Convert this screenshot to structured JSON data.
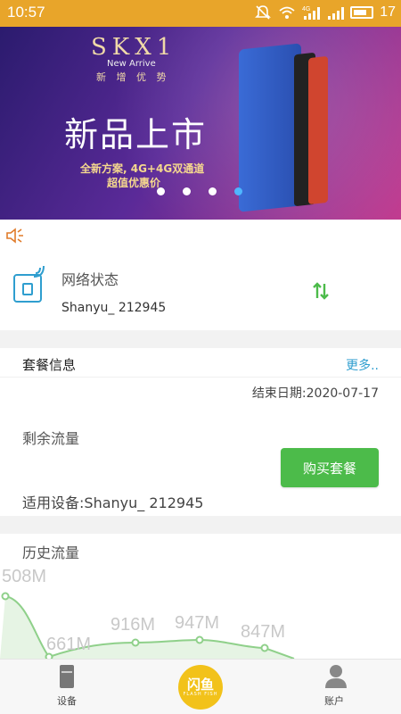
{
  "status_bar": {
    "time": "10:57",
    "battery_level": "17",
    "signal_label": "4G",
    "icons": [
      "mute-icon",
      "wifi-icon",
      "signal-4g-icon",
      "signal-icon",
      "battery-icon"
    ]
  },
  "banner": {
    "brand": "SKX1",
    "subtitle": "New Arrive",
    "subtitle_cn": "新 增 优 势",
    "headline": "新品上市",
    "tagline": "全新方案, 4G+4G双通道",
    "tagline2": "超值优惠价",
    "slide_count": 4,
    "active_slide": 4
  },
  "network": {
    "title": "网络状态",
    "device_name": "Shanyu_ 212945"
  },
  "plan": {
    "title": "套餐信息",
    "more": "更多..",
    "end_date_label": "结束日期:",
    "end_date": "2020-07-17",
    "remaining_label": "剩余流量",
    "buy_label": "购买套餐",
    "device_label": "适用设备:",
    "device_name": "Shanyu_ 212945"
  },
  "history": {
    "title": "历史流量"
  },
  "chart_data": {
    "type": "area",
    "categories": [
      "1",
      "2",
      "3",
      "4",
      "5"
    ],
    "series": [
      {
        "values": [
          508,
          661,
          916,
          947,
          847
        ]
      }
    ],
    "point_labels": [
      "508M",
      "661M",
      "916M",
      "947M",
      "847M"
    ],
    "color": "#8fd08a"
  },
  "bottom_nav": {
    "device_label": "设备",
    "center_main": "闪鱼",
    "center_sub": "FLASH FISH",
    "account_label": "账户"
  },
  "colors": {
    "status_bar": "#e8a52a",
    "accent_green": "#4cbb4a",
    "link_blue": "#2f9ecf",
    "brand_yellow": "#f2c21a"
  }
}
